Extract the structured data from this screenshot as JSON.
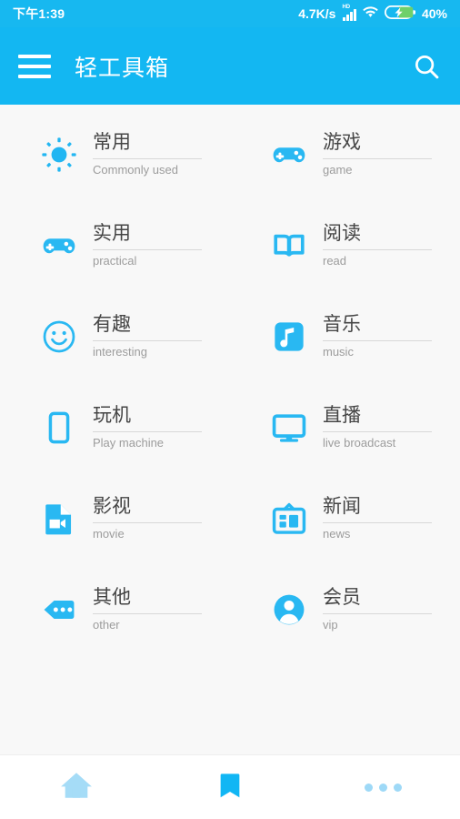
{
  "statusbar": {
    "time": "下午1:39",
    "network_speed": "4.7K/s",
    "signal_label": "HD",
    "signal_icon": "cellular-signal-icon",
    "wifi_icon": "wifi-icon",
    "battery_icon": "battery-charging-icon",
    "battery_percent": "40%"
  },
  "appbar": {
    "menu_icon": "hamburger-menu-icon",
    "title": "轻工具箱",
    "search_icon": "search-icon"
  },
  "colors": {
    "accent": "#13b7f2",
    "statusbar": "#17b8f0",
    "background": "#f8f8f8",
    "label": "#454545",
    "sublabel": "#9c9c9c",
    "divider": "#d8d8d8",
    "nav_inactive": "#9ed9f7",
    "nav_active": "#13b7f2",
    "battery_fill": "#6fd06a"
  },
  "categories": [
    {
      "cn": "常用",
      "en": "Commonly used",
      "icon": "sun-icon"
    },
    {
      "cn": "游戏",
      "en": "game",
      "icon": "gamepad-icon"
    },
    {
      "cn": "实用",
      "en": "practical",
      "icon": "gamepad-icon"
    },
    {
      "cn": "阅读",
      "en": "read",
      "icon": "open-book-icon"
    },
    {
      "cn": "有趣",
      "en": "interesting",
      "icon": "smiley-face-icon"
    },
    {
      "cn": "音乐",
      "en": "music",
      "icon": "music-note-icon"
    },
    {
      "cn": "玩机",
      "en": "Play machine",
      "icon": "smartphone-icon"
    },
    {
      "cn": "直播",
      "en": "live broadcast",
      "icon": "monitor-icon"
    },
    {
      "cn": "影视",
      "en": "movie",
      "icon": "video-file-icon"
    },
    {
      "cn": "新闻",
      "en": "news",
      "icon": "newspaper-icon"
    },
    {
      "cn": "其他",
      "en": "other",
      "icon": "tag-dots-icon"
    },
    {
      "cn": "会员",
      "en": "vip",
      "icon": "user-circle-icon"
    }
  ],
  "bottomnav": {
    "items": [
      {
        "name": "home",
        "icon": "home-icon",
        "active": false
      },
      {
        "name": "bookmark",
        "icon": "bookmark-icon",
        "active": true
      },
      {
        "name": "more",
        "icon": "more-dots-icon",
        "active": false
      }
    ]
  }
}
